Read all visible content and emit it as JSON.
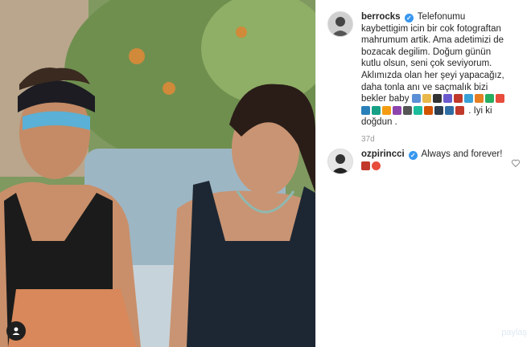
{
  "post": {
    "caption_user": "berrocks",
    "caption_text": "Telefonumu kaybettigim icin bir cok fotograftan mahrumum artik. Ama adetimizi de bozacak degilim. Doğum günün kutlu olsun, seni çok seviyorum. Aklımızda olan her şeyi yapacağız, daha tonla anı ve saçmalık bizi bekler baby",
    "caption_tail": ". Iyi ki doğdun .",
    "timestamp": "37d"
  },
  "comments": [
    {
      "user": "ozpirincci",
      "text": "Always and forever!"
    }
  ],
  "watermark": "paylaş",
  "icons": {
    "verified": "verified-badge-icon",
    "heart": "heart-outline-icon",
    "tag": "user-tag-icon"
  },
  "colors": {
    "verified": "#3897f0",
    "username": "#262626",
    "meta": "#999999"
  }
}
